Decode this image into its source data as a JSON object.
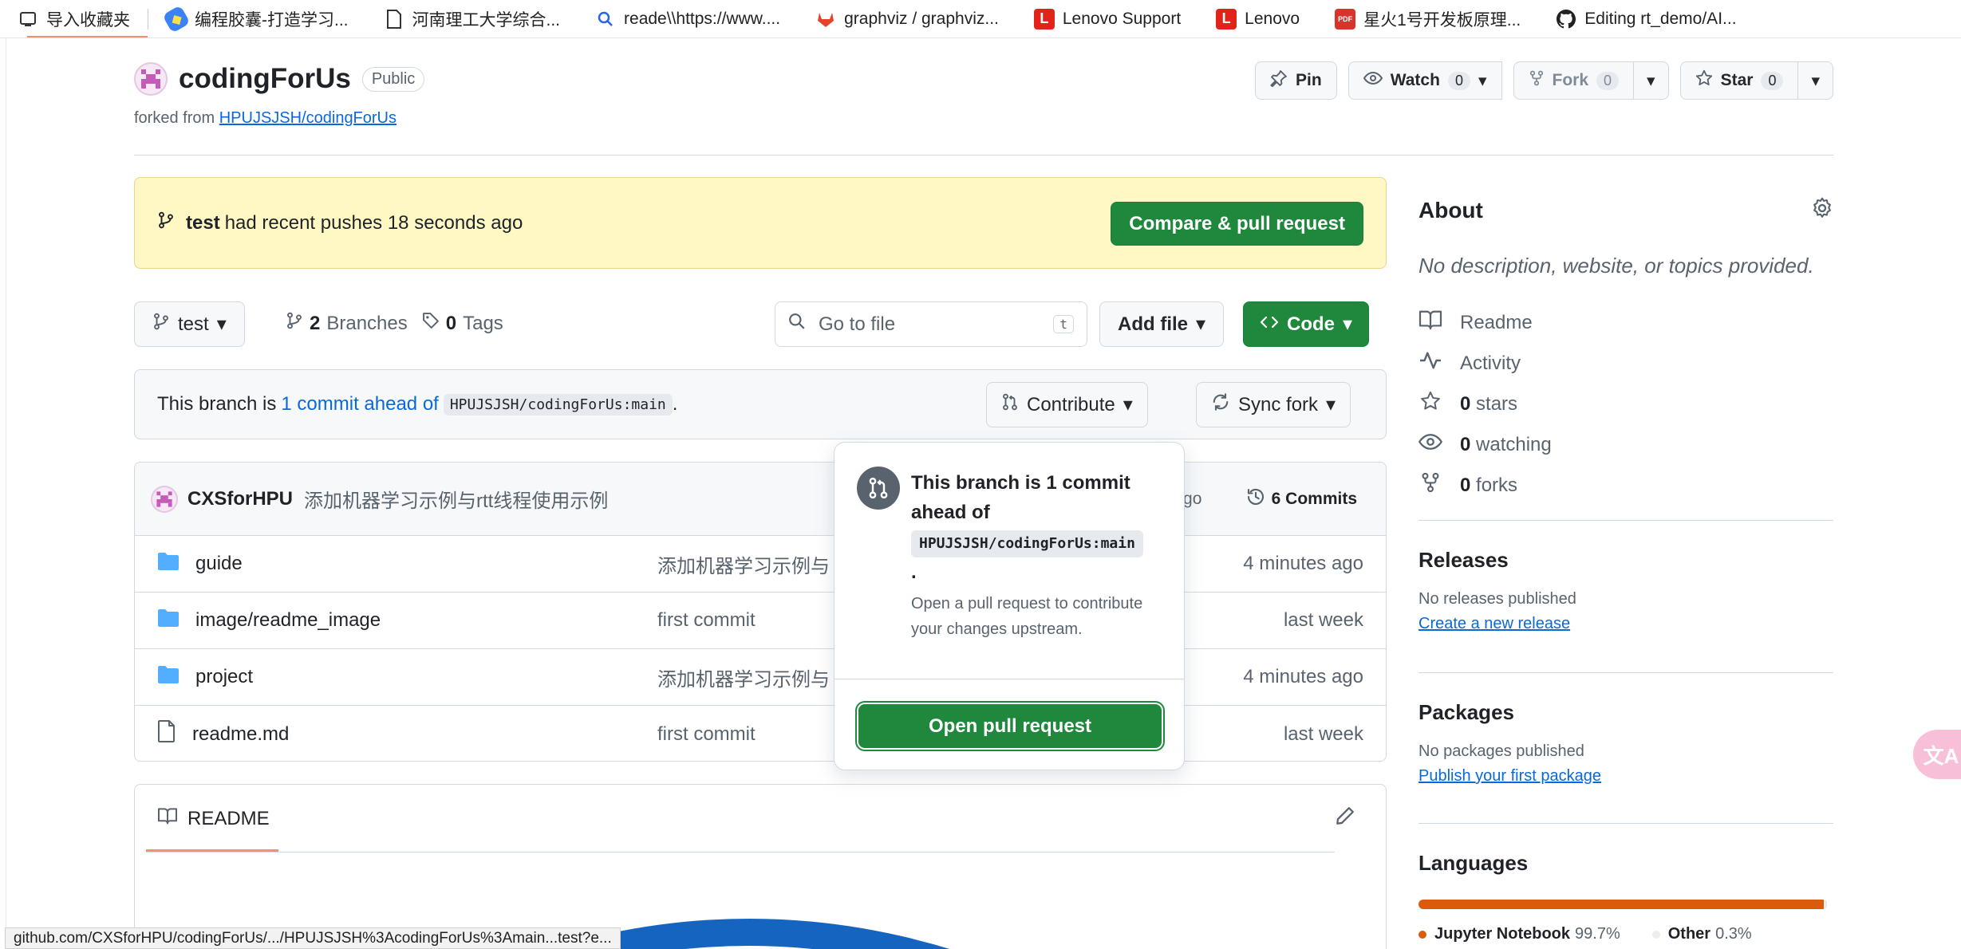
{
  "bookmarks": [
    {
      "label": "导入收藏夹",
      "icon": "import-icon"
    },
    {
      "label": "编程胶囊-打造学习...",
      "icon": "capsule-icon"
    },
    {
      "label": "河南理工大学综合...",
      "icon": "doc-icon"
    },
    {
      "label": "reade\\\\https://www....",
      "icon": "search-icon"
    },
    {
      "label": "graphviz / graphviz...",
      "icon": "gitlab-icon"
    },
    {
      "label": "Lenovo Support",
      "icon": "lenovo-icon"
    },
    {
      "label": "Lenovo",
      "icon": "lenovo-icon"
    },
    {
      "label": "星火1号开发板原理...",
      "icon": "pdf-icon"
    },
    {
      "label": "Editing rt_demo/AI...",
      "icon": "github-icon"
    }
  ],
  "repo": {
    "name": "codingForUs",
    "visibility": "Public",
    "forked_prefix": "forked from",
    "forked_from": "HPUJSJSH/codingForUs"
  },
  "actions": {
    "pin": "Pin",
    "watch": "Watch",
    "watch_count": "0",
    "fork": "Fork",
    "fork_count": "0",
    "star": "Star",
    "star_count": "0"
  },
  "flash": {
    "branch": "test",
    "text": "had recent pushes 18 seconds ago",
    "button": "Compare & pull request"
  },
  "toolbar": {
    "branch": "test",
    "branches_count": "2",
    "branches_label": "Branches",
    "tags_count": "0",
    "tags_label": "Tags",
    "go_to_file": "Go to file",
    "shortcut": "t",
    "add_file": "Add file",
    "code": "Code"
  },
  "ahead": {
    "prefix": "This branch is",
    "link": "1 commit ahead of",
    "ref": "HPUJSJSH/codingForUs:main",
    "suffix": ".",
    "contribute": "Contribute",
    "sync_fork": "Sync fork"
  },
  "latest_commit": {
    "author": "CXSforHPU",
    "message": "添加机器学习示例与rtt线程使用示例",
    "time_fragment": "s ago",
    "commits_label": "6 Commits"
  },
  "files": [
    {
      "name": "guide",
      "type": "folder",
      "message": "添加机器学习示例与",
      "time": "4 minutes ago"
    },
    {
      "name": "image/readme_image",
      "type": "folder",
      "message": "first commit",
      "time": "last week"
    },
    {
      "name": "project",
      "type": "folder",
      "message": "添加机器学习示例与",
      "time": "4 minutes ago"
    },
    {
      "name": "readme.md",
      "type": "file",
      "message": "first commit",
      "time": "last week"
    }
  ],
  "readme": {
    "tab": "README"
  },
  "popover": {
    "title_line1": "This branch is 1 commit",
    "title_line2": "ahead of",
    "ref": "HPUJSJSH/codingForUs:main",
    "dot": ".",
    "description": "Open a pull request to contribute your changes upstream.",
    "button": "Open pull request"
  },
  "about": {
    "title": "About",
    "description": "No description, website, or topics provided.",
    "items": [
      {
        "icon": "book-icon",
        "label": "Readme",
        "count": ""
      },
      {
        "icon": "pulse-icon",
        "label": "Activity",
        "count": ""
      },
      {
        "icon": "star-icon",
        "label": "stars",
        "count": "0"
      },
      {
        "icon": "eye-icon",
        "label": "watching",
        "count": "0"
      },
      {
        "icon": "fork-icon",
        "label": "forks",
        "count": "0"
      }
    ]
  },
  "releases": {
    "title": "Releases",
    "empty": "No releases published",
    "link": "Create a new release"
  },
  "packages": {
    "title": "Packages",
    "empty": "No packages published",
    "link": "Publish your first package"
  },
  "languages": {
    "title": "Languages",
    "items": [
      {
        "name": "Jupyter Notebook",
        "percent": "99.7%",
        "share": 99.7,
        "color": "#da5b0b"
      },
      {
        "name": "Other",
        "percent": "0.3%",
        "share": 0.3,
        "color": "#ededed"
      }
    ]
  },
  "status_url": "github.com/CXSforHPU/codingForUs/.../HPUJSJSH%3AcodingForUs%3Amain...test?e...",
  "colors": {
    "accent": "#0969da",
    "primary_button": "#1f883d",
    "flash_bg": "#fff8c5"
  }
}
